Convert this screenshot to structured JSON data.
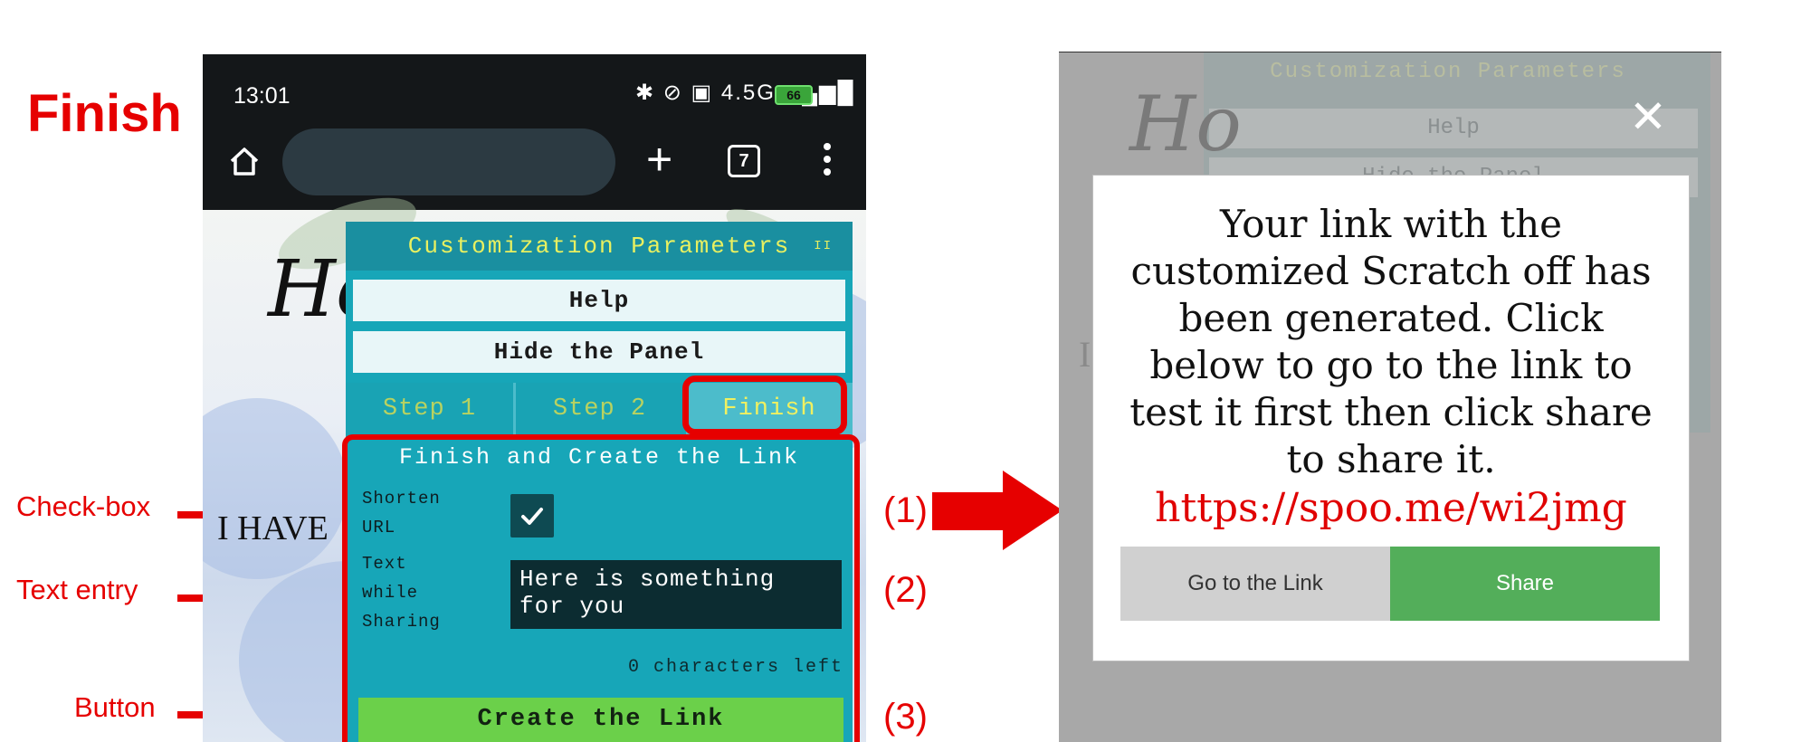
{
  "heading": "Finish",
  "annotations": {
    "checkbox_label": "Check-box",
    "text_entry_label": "Text entry",
    "button_label": "Button",
    "num1": "(1)",
    "num2": "(2)",
    "num3": "(3)"
  },
  "phone": {
    "status_time": "13:01",
    "status_icons": "✱ ⊘ ▣ 4.5G ▂▄▆█",
    "battery": "66",
    "tab_count": "7",
    "page_script": "Ho",
    "page_text": "I HAVE"
  },
  "panel": {
    "title": "Customization Parameters",
    "title_icon": "II",
    "help_label": "Help",
    "hide_label": "Hide the Panel",
    "tabs": [
      "Step 1",
      "Step 2",
      "Finish"
    ],
    "active_tab": "Finish",
    "section_title": "Finish and Create the Link",
    "shorten_url_label": [
      "Shorten",
      "URL"
    ],
    "shorten_url_checked": true,
    "text_sharing_label": [
      "Text",
      "while",
      "Sharing"
    ],
    "text_sharing_value": "Here is something for you",
    "chars_left": "0 characters left",
    "create_button": "Create the Link"
  },
  "dialog": {
    "bg_title": "Customization Parameters",
    "bg_help": "Help",
    "bg_hide": "Hide the Panel",
    "bg_script": "Ho",
    "bg_letter": "I",
    "close": "✕",
    "message": "Your link with the customized Scratch off has been generated. Click below to go to the link to test it first then click share to share it.",
    "link": "https://spoo.me/wi2jmg",
    "go_button": "Go to the Link",
    "share_button": "Share"
  },
  "colors": {
    "annotation_red": "#e60000",
    "panel_teal": "#17a6b8",
    "panel_title_yellow": "#e8f060",
    "create_green": "#6bd04a",
    "share_green": "#53ae5a"
  }
}
